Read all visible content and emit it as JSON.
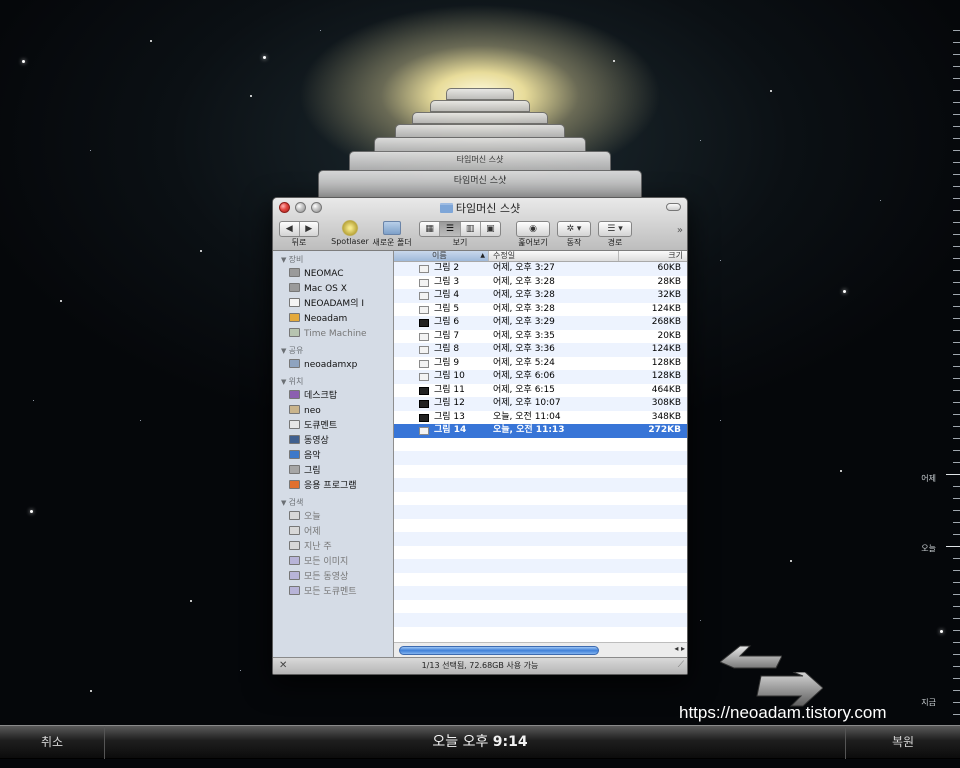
{
  "window": {
    "title": "타임머신 스샷",
    "back_title_1": "타임머신 스샷",
    "back_title_2": "타임머신 스샷"
  },
  "toolbar": {
    "back_label": "뒤로",
    "spotlaser_label": "Spotlaser",
    "new_folder_label": "새로운 폴더",
    "view_label": "보기",
    "quicklook_label": "훑어보기",
    "action_label": "동작",
    "path_label": "경로"
  },
  "sidebar": {
    "sections": [
      {
        "label": "장비",
        "items": [
          {
            "label": "NEOMAC",
            "icon": "harddisk-icon",
            "dim": false
          },
          {
            "label": "Mac OS X",
            "icon": "harddisk-icon",
            "dim": false
          },
          {
            "label": "NEOADAM의 I",
            "icon": "ipod-icon",
            "dim": false
          },
          {
            "label": "Neoadam",
            "icon": "drive-icon",
            "dim": false
          },
          {
            "label": "Time Machine",
            "icon": "timemachine-icon",
            "dim": true
          }
        ]
      },
      {
        "label": "공유",
        "items": [
          {
            "label": "neoadamxp",
            "icon": "network-computer-icon",
            "dim": false
          }
        ]
      },
      {
        "label": "위치",
        "items": [
          {
            "label": "데스크탑",
            "icon": "desktop-icon",
            "dim": false
          },
          {
            "label": "neo",
            "icon": "home-icon",
            "dim": false
          },
          {
            "label": "도큐멘트",
            "icon": "documents-icon",
            "dim": false
          },
          {
            "label": "동영상",
            "icon": "movies-icon",
            "dim": false
          },
          {
            "label": "음악",
            "icon": "music-icon",
            "dim": false
          },
          {
            "label": "그림",
            "icon": "pictures-icon",
            "dim": false
          },
          {
            "label": "응용 프로그램",
            "icon": "applications-icon",
            "dim": false
          }
        ]
      },
      {
        "label": "검색",
        "items": [
          {
            "label": "오늘",
            "icon": "clock-icon",
            "dim": true
          },
          {
            "label": "어제",
            "icon": "clock-icon",
            "dim": true
          },
          {
            "label": "지난 주",
            "icon": "clock-icon",
            "dim": true
          },
          {
            "label": "모든 이미지",
            "icon": "smart-folder-icon",
            "dim": true
          },
          {
            "label": "모든 동영상",
            "icon": "smart-folder-icon",
            "dim": true
          },
          {
            "label": "모든 도큐멘트",
            "icon": "smart-folder-icon",
            "dim": true
          }
        ]
      }
    ]
  },
  "list": {
    "columns": {
      "name": "이름",
      "date": "수정일",
      "size": "크기"
    },
    "rows": [
      {
        "name": "그림 2",
        "date": "어제, 오후 3:27",
        "size": "60KB",
        "dark": false,
        "selected": false
      },
      {
        "name": "그림 3",
        "date": "어제, 오후 3:28",
        "size": "28KB",
        "dark": false,
        "selected": false
      },
      {
        "name": "그림 4",
        "date": "어제, 오후 3:28",
        "size": "32KB",
        "dark": false,
        "selected": false
      },
      {
        "name": "그림 5",
        "date": "어제, 오후 3:28",
        "size": "124KB",
        "dark": false,
        "selected": false
      },
      {
        "name": "그림 6",
        "date": "어제, 오후 3:29",
        "size": "268KB",
        "dark": true,
        "selected": false
      },
      {
        "name": "그림 7",
        "date": "어제, 오후 3:35",
        "size": "20KB",
        "dark": false,
        "selected": false
      },
      {
        "name": "그림 8",
        "date": "어제, 오후 3:36",
        "size": "124KB",
        "dark": false,
        "selected": false
      },
      {
        "name": "그림 9",
        "date": "어제, 오후 5:24",
        "size": "128KB",
        "dark": false,
        "selected": false
      },
      {
        "name": "그림 10",
        "date": "어제, 오후 6:06",
        "size": "128KB",
        "dark": false,
        "selected": false
      },
      {
        "name": "그림 11",
        "date": "어제, 오후 6:15",
        "size": "464KB",
        "dark": true,
        "selected": false
      },
      {
        "name": "그림 12",
        "date": "어제, 오후 10:07",
        "size": "308KB",
        "dark": true,
        "selected": false
      },
      {
        "name": "그림 13",
        "date": "오늘, 오전 11:04",
        "size": "348KB",
        "dark": true,
        "selected": false
      },
      {
        "name": "그림 14",
        "date": "오늘, 오전 11:13",
        "size": "272KB",
        "dark": false,
        "selected": true
      }
    ]
  },
  "status": {
    "text": "1/13 선택됨, 72.68GB 사용 가능"
  },
  "timeline": {
    "label_yesterday": "어제",
    "label_today": "오늘",
    "label_now": "지금"
  },
  "bottombar": {
    "cancel": "취소",
    "time_prefix": "오늘 오후 ",
    "time_value": "9:14",
    "restore": "복원"
  },
  "watermark": "https://neoadam.tistory.com"
}
